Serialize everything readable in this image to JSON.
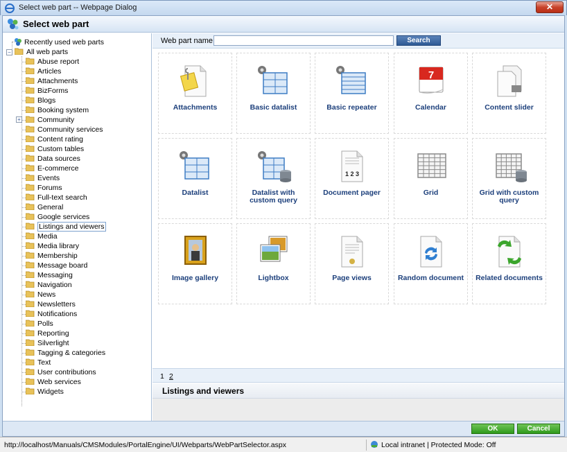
{
  "window": {
    "title": "Select web part -- Webpage Dialog",
    "close_glyph": "✕"
  },
  "header": {
    "title": "Select web part"
  },
  "tree": {
    "recent": "Recently used web parts",
    "root": "All web parts",
    "items": [
      {
        "label": "Abuse report"
      },
      {
        "label": "Articles"
      },
      {
        "label": "Attachments"
      },
      {
        "label": "BizForms"
      },
      {
        "label": "Blogs"
      },
      {
        "label": "Booking system"
      },
      {
        "label": "Community",
        "expandable": true
      },
      {
        "label": "Community services"
      },
      {
        "label": "Content rating"
      },
      {
        "label": "Custom tables"
      },
      {
        "label": "Data sources"
      },
      {
        "label": "E-commerce"
      },
      {
        "label": "Events"
      },
      {
        "label": "Forums"
      },
      {
        "label": "Full-text search"
      },
      {
        "label": "General"
      },
      {
        "label": "Google services"
      },
      {
        "label": "Listings and viewers",
        "selected": true
      },
      {
        "label": "Media"
      },
      {
        "label": "Media library"
      },
      {
        "label": "Membership"
      },
      {
        "label": "Message board"
      },
      {
        "label": "Messaging"
      },
      {
        "label": "Navigation"
      },
      {
        "label": "News"
      },
      {
        "label": "Newsletters"
      },
      {
        "label": "Notifications"
      },
      {
        "label": "Polls"
      },
      {
        "label": "Reporting"
      },
      {
        "label": "Silverlight"
      },
      {
        "label": "Tagging & categories"
      },
      {
        "label": "Text"
      },
      {
        "label": "User contributions"
      },
      {
        "label": "Web services"
      },
      {
        "label": "Widgets"
      }
    ]
  },
  "search": {
    "label": "Web part name:",
    "value": "",
    "button": "Search"
  },
  "webparts": [
    {
      "label": "Attachments",
      "icon": "attachment-icon"
    },
    {
      "label": "Basic datalist",
      "icon": "basic-datalist-icon"
    },
    {
      "label": "Basic repeater",
      "icon": "basic-repeater-icon"
    },
    {
      "label": "Calendar",
      "icon": "calendar-icon",
      "day": "7"
    },
    {
      "label": "Content slider",
      "icon": "content-slider-icon"
    },
    {
      "label": "Datalist",
      "icon": "datalist-icon"
    },
    {
      "label": "Datalist with custom query",
      "icon": "datalist-query-icon"
    },
    {
      "label": "Document pager",
      "icon": "document-pager-icon",
      "pages": "1 2 3"
    },
    {
      "label": "Grid",
      "icon": "grid-icon"
    },
    {
      "label": "Grid with custom query",
      "icon": "grid-query-icon"
    },
    {
      "label": "Image gallery",
      "icon": "image-gallery-icon"
    },
    {
      "label": "Lightbox",
      "icon": "lightbox-icon"
    },
    {
      "label": "Page views",
      "icon": "page-views-icon"
    },
    {
      "label": "Random document",
      "icon": "random-document-icon"
    },
    {
      "label": "Related documents",
      "icon": "related-documents-icon"
    }
  ],
  "pager": {
    "pages": [
      "1",
      "2"
    ],
    "current": "1"
  },
  "description": {
    "title": "Listings and viewers"
  },
  "footer": {
    "ok": "OK",
    "cancel": "Cancel"
  },
  "status": {
    "url": "http://localhost/Manuals/CMSModules/PortalEngine/UI/Webparts/WebPartSelector.aspx",
    "zone": "Local intranet | Protected Mode: Off"
  }
}
